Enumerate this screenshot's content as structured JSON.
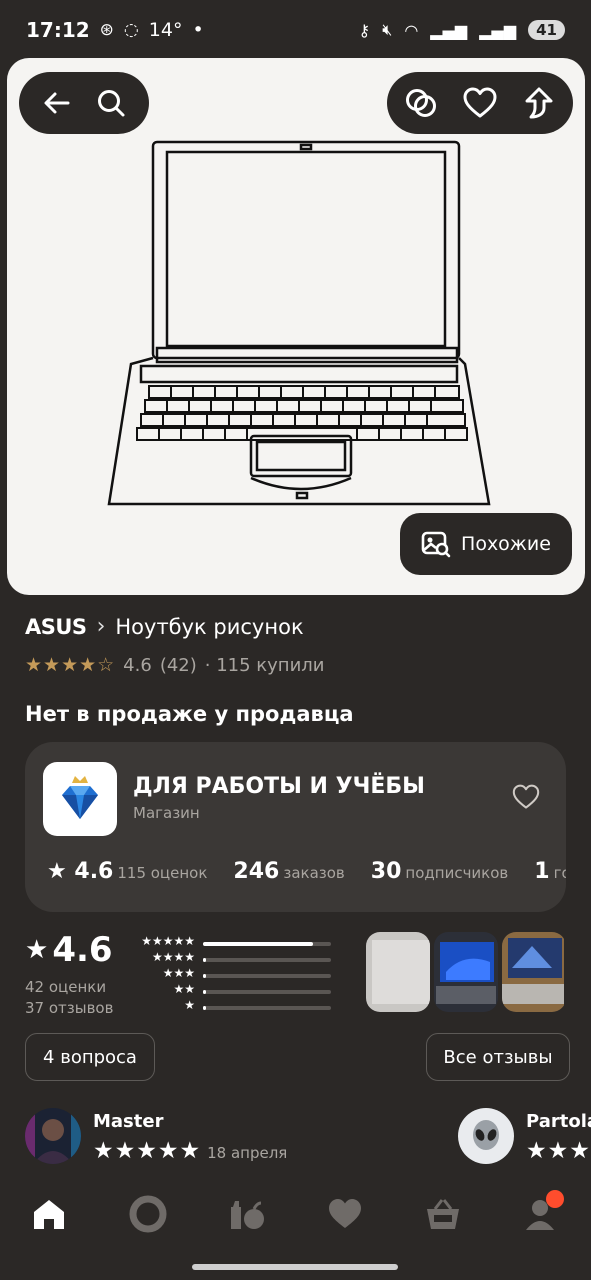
{
  "status_bar": {
    "time": "17:12",
    "temperature": "14°",
    "dot": "•",
    "battery": "41"
  },
  "hero": {
    "similar_label": "Похожие"
  },
  "product": {
    "brand": "ASUS",
    "separator": "›",
    "title": "Ноутбук рисунок",
    "stars": "★★★★☆",
    "rating": "4.6",
    "reviews_count": "(42)",
    "bought": "· 115 купили",
    "availability": "Нет в продаже у продавца"
  },
  "shop": {
    "name": "ДЛЯ РАБОТЫ И УЧЁБЫ",
    "type": "Магазин",
    "stats": [
      {
        "value": "★ 4.6",
        "label": "115 оценок"
      },
      {
        "value": "246",
        "label": "заказов"
      },
      {
        "value": "30",
        "label": "подписчиков"
      },
      {
        "value": "1",
        "label": "год"
      }
    ]
  },
  "reviews_summary": {
    "rating": "4.6",
    "ratings_count": "42 оценки",
    "reviews_count": "37 отзывов",
    "distribution": [
      {
        "stars": "★★★★★",
        "share": 0.86
      },
      {
        "stars": "★★★★",
        "share": 0.02
      },
      {
        "stars": "★★★",
        "share": 0.02
      },
      {
        "stars": "★★",
        "share": 0.02
      },
      {
        "stars": "★",
        "share": 0.02
      }
    ]
  },
  "buttons": {
    "questions": "4 вопроса",
    "all_reviews": "Все отзывы"
  },
  "reviews": [
    {
      "author": "Master",
      "stars": "★★★★★",
      "date": "18 апреля"
    },
    {
      "author": "Partola",
      "stars": "★★★",
      "date": ""
    }
  ],
  "colors": {
    "background": "#2b2826",
    "card": "#3b3836",
    "star_gold": "#c49a59",
    "badge": "#ff4d2d"
  }
}
